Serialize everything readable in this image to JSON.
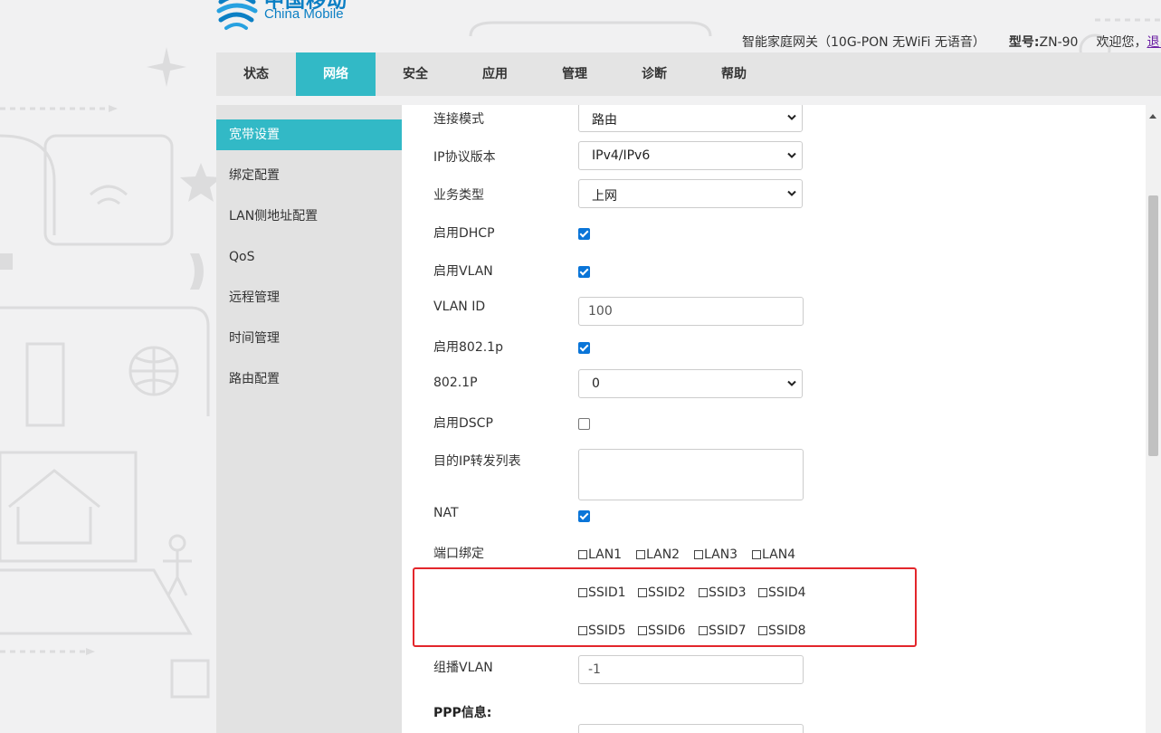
{
  "header": {
    "logo_cn": "中国移动",
    "logo_en": "China Mobile",
    "device": "智能家庭网关（10G-PON 无WiFi 无语音）",
    "model_label": "型号:",
    "model_value": "ZN-90",
    "welcome": "欢迎您，",
    "logout": "退出"
  },
  "nav": {
    "tabs": [
      {
        "label": "状态"
      },
      {
        "label": "网络"
      },
      {
        "label": "安全"
      },
      {
        "label": "应用"
      },
      {
        "label": "管理"
      },
      {
        "label": "诊断"
      },
      {
        "label": "帮助"
      }
    ],
    "active": "网络"
  },
  "sidebar": {
    "items": [
      {
        "label": "宽带设置"
      },
      {
        "label": "绑定配置"
      },
      {
        "label": "LAN侧地址配置"
      },
      {
        "label": "QoS"
      },
      {
        "label": "远程管理"
      },
      {
        "label": "时间管理"
      },
      {
        "label": "路由配置"
      }
    ],
    "active": "宽带设置"
  },
  "form": {
    "connection_mode": {
      "label": "连接模式",
      "value": "路由"
    },
    "ip_version": {
      "label": "IP协议版本",
      "value": "IPv4/IPv6"
    },
    "service_type": {
      "label": "业务类型",
      "value": "上网"
    },
    "enable_dhcp": {
      "label": "启用DHCP",
      "checked": true
    },
    "enable_vlan": {
      "label": "启用VLAN",
      "checked": true
    },
    "vlan_id": {
      "label": "VLAN ID",
      "value": "100"
    },
    "enable_8021p": {
      "label": "启用802.1p",
      "checked": true
    },
    "p8021": {
      "label": "802.1P",
      "value": "0"
    },
    "enable_dscp": {
      "label": "启用DSCP",
      "checked": false
    },
    "dest_ip_list": {
      "label": "目的IP转发列表",
      "value": ""
    },
    "nat": {
      "label": "NAT",
      "checked": true
    },
    "port_binding": {
      "label": "端口绑定",
      "lan": [
        "LAN1",
        "LAN2",
        "LAN3",
        "LAN4"
      ],
      "ssid_row1": [
        "SSID1",
        "SSID2",
        "SSID3",
        "SSID4"
      ],
      "ssid_row2": [
        "SSID5",
        "SSID6",
        "SSID7",
        "SSID8"
      ]
    },
    "multicast_vlan": {
      "label": "组播VLAN",
      "value": "-1"
    },
    "ppp_info": {
      "label": "PPP信息:"
    }
  },
  "colors": {
    "accent": "#32b9c6",
    "highlight": "#e3262b",
    "brand": "#0b7fc4"
  }
}
